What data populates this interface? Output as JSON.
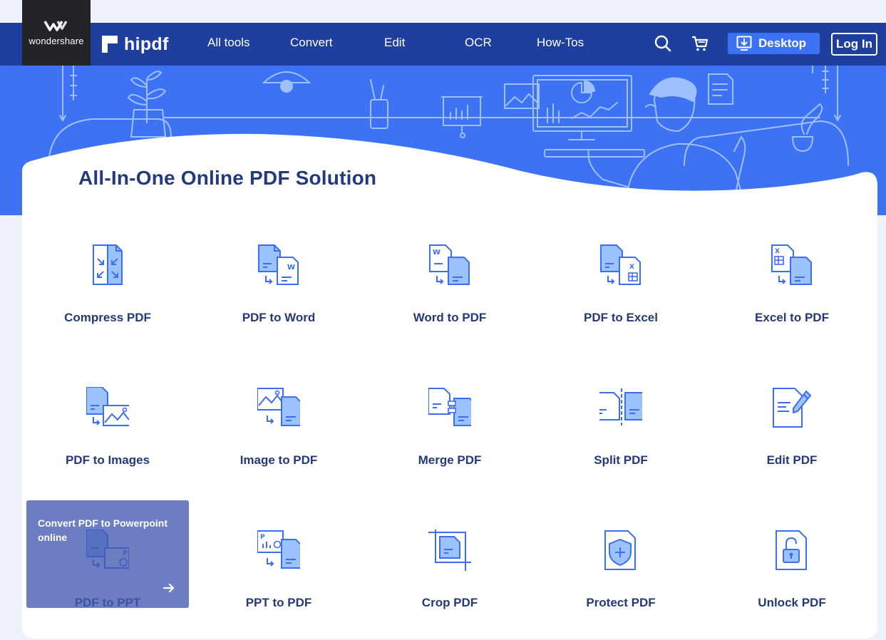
{
  "brand": {
    "company": "wondershare",
    "product": "hipdf"
  },
  "nav": {
    "items": [
      "All tools",
      "Convert",
      "Edit",
      "OCR",
      "How-Tos"
    ],
    "desktop_label": "Desktop",
    "login_label": "Log In"
  },
  "hero": {
    "headline": "All-In-One Online PDF Solution"
  },
  "tools": [
    {
      "label": "Compress PDF",
      "icon": "compress-pdf-icon"
    },
    {
      "label": "PDF to Word",
      "icon": "pdf-to-word-icon"
    },
    {
      "label": "Word to PDF",
      "icon": "word-to-pdf-icon"
    },
    {
      "label": "PDF to Excel",
      "icon": "pdf-to-excel-icon"
    },
    {
      "label": "Excel to PDF",
      "icon": "excel-to-pdf-icon"
    },
    {
      "label": "PDF to Images",
      "icon": "pdf-to-images-icon"
    },
    {
      "label": "Image to PDF",
      "icon": "image-to-pdf-icon"
    },
    {
      "label": "Merge PDF",
      "icon": "merge-pdf-icon"
    },
    {
      "label": "Split PDF",
      "icon": "split-pdf-icon"
    },
    {
      "label": "Edit PDF",
      "icon": "edit-pdf-icon"
    },
    {
      "label": "PDF to PPT",
      "icon": "pdf-to-ppt-icon"
    },
    {
      "label": "PPT to PDF",
      "icon": "ppt-to-pdf-icon"
    },
    {
      "label": "Crop PDF",
      "icon": "crop-pdf-icon"
    },
    {
      "label": "Protect PDF",
      "icon": "protect-pdf-icon"
    },
    {
      "label": "Unlock PDF",
      "icon": "unlock-pdf-icon"
    }
  ],
  "tooltip": {
    "text": "Convert PDF to Powerpoint online"
  },
  "colors": {
    "nav_bg": "#1f3f9e",
    "hero_bg": "#3d72f4",
    "accent": "#3c73f5",
    "text_dark": "#24397a",
    "icon_fill": "#9cc2fb",
    "icon_stroke": "#3d6ef0"
  }
}
